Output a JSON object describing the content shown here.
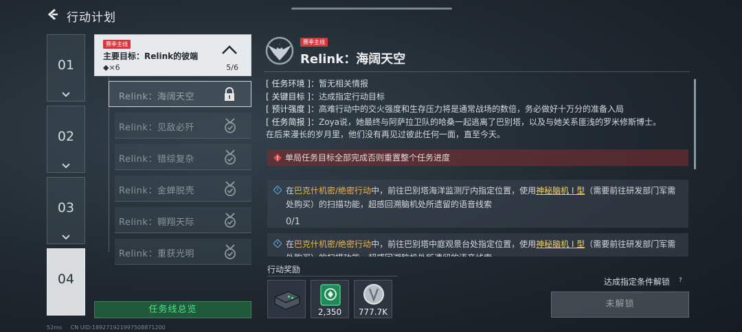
{
  "header": {
    "title": "行动计划"
  },
  "chapters": [
    "01",
    "02",
    "03",
    "04"
  ],
  "quest": {
    "tag": "赛季主线",
    "title": "主要目标：Relink的彼端",
    "reward": "◆×6",
    "progress": "5/6"
  },
  "subquests": [
    {
      "label": "Relink：海阔天空",
      "icon": "lock-icon"
    },
    {
      "label": "Relink：见敌必歼",
      "icon": "medal-check-icon"
    },
    {
      "label": "Relink：错综复杂",
      "icon": "medal-check-icon"
    },
    {
      "label": "Relink：金蝉脱壳",
      "icon": "medal-check-icon"
    },
    {
      "label": "Relink：翱翔天际",
      "icon": "medal-check-icon"
    },
    {
      "label": "Relink：重获光明",
      "icon": "medal-check-icon"
    }
  ],
  "overview_button": "任务线总览",
  "mission": {
    "tag": "赛季主线",
    "title": "Relink：海阔天空",
    "env_key": "[ 任务环境 ]：",
    "env_val": "暂无相关情报",
    "target_key": "[ 关键目标 ]：",
    "target_val": "达成指定行动目标",
    "intensity_key": "[ 预计强度 ]：",
    "intensity_val": "高难行动中的交火强度和生存压力将是通常战场的数倍，务必做好十万分的准备入局",
    "brief_key": "[ 任务简报 ]：",
    "brief_val": "Zoya说，她最终与阿萨拉卫队的哈桑一起逃离了巴别塔，以及与她关系匪浅的罗米修斯博士。",
    "brief_val2": "在后来漫长的岁月里，他们没有再见过彼此任何一面，直至今天。",
    "warning": "单局任务目标全部完成否则重置整个任务进度"
  },
  "objectives": [
    {
      "prefix": "在",
      "op": "巴克什机密/绝密行动",
      "mid": "中，前往巴别塔海洋监测厅内指定位置，使用",
      "item": "神秘脑机 I 型",
      "suffix": "（需要前往研发部门军需处购买）的扫描功能，超感回溯脑机处所遗留的语音线索",
      "count": "0/1"
    },
    {
      "prefix": "在",
      "op": "巴克什机密/绝密行动",
      "mid": "中，前往巴别塔中庭观景台处指定位置，使用",
      "item": "神秘脑机 I 型",
      "suffix": "（需要前往研发部门军需处购买）的扫描功能，超感回溯脑机处所遗留的语音线索",
      "count": ""
    }
  ],
  "rewards": {
    "label": "行动奖励",
    "items": [
      {
        "icon": "device-case-icon",
        "amount": ""
      },
      {
        "icon": "green-emblem-icon",
        "amount": "2,350"
      },
      {
        "icon": "silver-coin-icon",
        "amount": "777.7K"
      }
    ]
  },
  "unlock": {
    "hint": "达成指定条件解锁",
    "q": "?",
    "button": "未解锁"
  },
  "status": {
    "ping": "52ms",
    "cn": "CN UID:1892719219975088712​00"
  },
  "colors": {
    "accent_green": "#49e28a",
    "tag_red": "#d8363a",
    "highlight_orange": "#f0b44a",
    "warning_bg": "#782d30"
  }
}
